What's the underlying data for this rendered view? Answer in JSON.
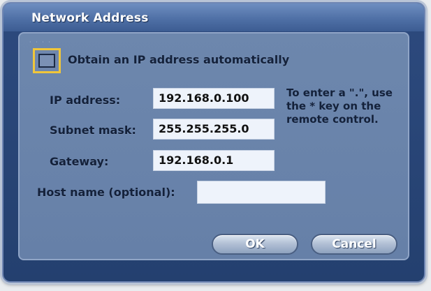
{
  "dialog": {
    "title": "Network Address"
  },
  "auto_ip": {
    "label": "Obtain an IP address automatically",
    "checked": false
  },
  "fields": {
    "ip": {
      "label": "IP address:",
      "value": "192.168.0.100"
    },
    "subnet": {
      "label": "Subnet mask:",
      "value": "255.255.255.0"
    },
    "gateway": {
      "label": "Gateway:",
      "value": "192.168.0.1"
    },
    "host": {
      "label": "Host name (optional):",
      "value": ""
    }
  },
  "hint": {
    "line1": "To enter a \".\", use",
    "line2": "the * key on the",
    "line3": "remote control."
  },
  "buttons": {
    "ok": "OK",
    "cancel": "Cancel"
  },
  "colors": {
    "dialog_bg": "#2d4a7e",
    "panel_bg": "#6d87ad",
    "focus": "#f0c63a",
    "field_bg": "#eef3fb"
  }
}
